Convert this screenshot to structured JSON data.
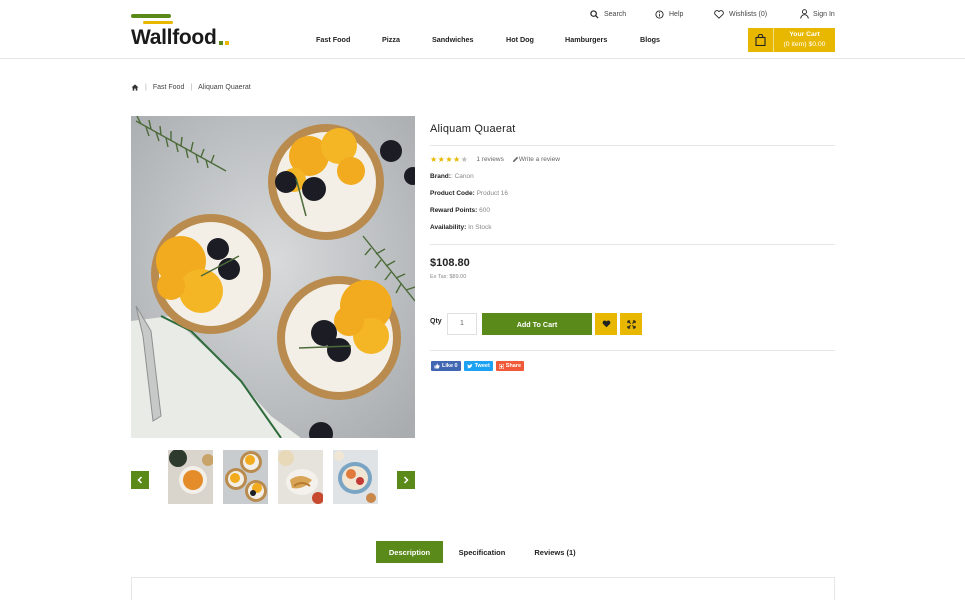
{
  "brand": {
    "logo_text": "Wallfood"
  },
  "toplinks": {
    "search": "Search",
    "help": "Help",
    "wishlist": "Wishlists (0)",
    "signin": "Sign In"
  },
  "nav": [
    "Fast Food",
    "Pizza",
    "Sandwiches",
    "Hot Dog",
    "Hamburgers",
    "Blogs"
  ],
  "cart": {
    "title": "Your Cart",
    "summary": "(0 item) $0.00"
  },
  "breadcrumb": {
    "home_icon": "home-icon",
    "items": [
      "Fast Food",
      "Aliquam Quaerat"
    ]
  },
  "product": {
    "title": "Aliquam Quaerat",
    "rating": 4,
    "rating_max": 5,
    "reviews": "1 reviews",
    "write_review": "Write a review",
    "specs": [
      {
        "label": "Brand:",
        "value": ": Canon"
      },
      {
        "label": "Product Code:",
        "value": "Product 16"
      },
      {
        "label": "Reward Points:",
        "value": "600"
      },
      {
        "label": "Availability:",
        "value": "In Stock"
      }
    ],
    "price": "$108.80",
    "ex_tax": "Ex Tax: $89.00",
    "qty_label": "Qty",
    "qty_value": "1",
    "add_to_cart": "Add To Cart"
  },
  "social": [
    {
      "label": "Like 0",
      "color": "#4267b2"
    },
    {
      "label": "Tweet",
      "color": "#1da1f2"
    },
    {
      "label": "Share",
      "color": "#f05a38"
    }
  ],
  "tabs": [
    "Description",
    "Specification",
    "Reviews (1)"
  ],
  "colors": {
    "accent_green": "#5a8a1a",
    "accent_yellow": "#e8b800"
  }
}
